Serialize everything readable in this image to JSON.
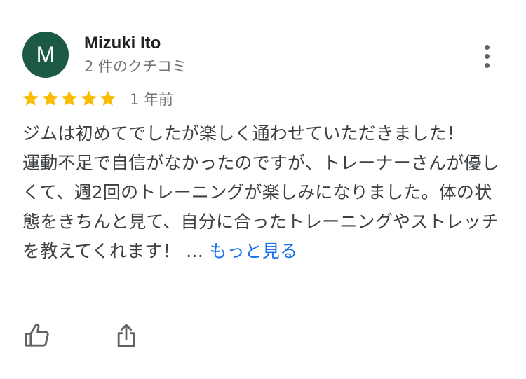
{
  "reviewer": {
    "avatar_initial": "M",
    "avatar_color": "#1c5a44",
    "name": "Mizuki Ito",
    "review_count": "2 件のクチコミ"
  },
  "menu": {
    "icon": "more-vert-icon"
  },
  "rating": {
    "stars": 5,
    "max": 5,
    "star_color": "#fbbc04",
    "time": "1 年前"
  },
  "review": {
    "paragraphs": [
      "ジムは初めてでしたが楽しく通わせていただきました！",
      "運動不足で自信がなかったのですが、トレーナーさんが優しくて、週2回のトレーニングが楽しみになりました。体の状態をきちんと見て、自分に合ったトレーニングやストレッチを教えてくれます！ …"
    ],
    "more_label": "もっと見る",
    "link_color": "#1a73e8"
  },
  "actions": {
    "like_icon": "thumb-up-icon",
    "share_icon": "share-icon"
  }
}
